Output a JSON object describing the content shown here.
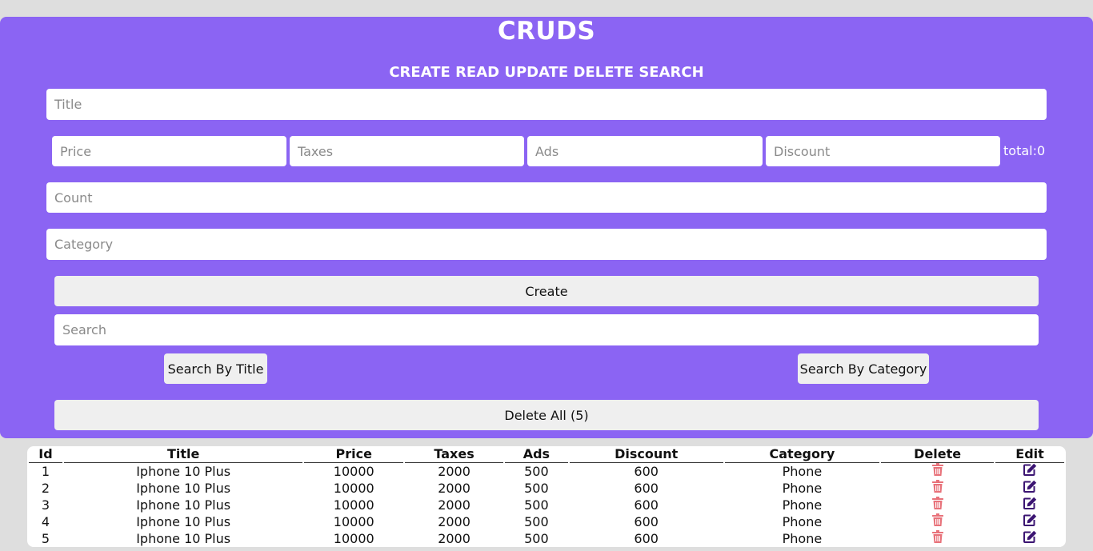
{
  "header": {
    "title": "CRUDS",
    "subtitle": "CREATE READ UPDATE DELETE SEARCH"
  },
  "form": {
    "title_placeholder": "Title",
    "price_placeholder": "Price",
    "taxes_placeholder": "Taxes",
    "ads_placeholder": "Ads",
    "discount_placeholder": "Discount",
    "total_label": "total:0",
    "count_placeholder": "Count",
    "category_placeholder": "Category",
    "create_label": "Create",
    "search_placeholder": "Search",
    "search_by_title_label": "Search By Title",
    "search_by_category_label": "Search By Category",
    "delete_all_label": "Delete All (5)"
  },
  "table": {
    "headers": [
      "Id",
      "Title",
      "Price",
      "Taxes",
      "Ads",
      "Discount",
      "Category",
      "Delete",
      "Edit"
    ],
    "rows": [
      {
        "id": "1",
        "title": "Iphone 10 Plus",
        "price": "10000",
        "taxes": "2000",
        "ads": "500",
        "discount": "600",
        "category": "Phone"
      },
      {
        "id": "2",
        "title": "Iphone 10 Plus",
        "price": "10000",
        "taxes": "2000",
        "ads": "500",
        "discount": "600",
        "category": "Phone"
      },
      {
        "id": "3",
        "title": "Iphone 10 Plus",
        "price": "10000",
        "taxes": "2000",
        "ads": "500",
        "discount": "600",
        "category": "Phone"
      },
      {
        "id": "4",
        "title": "Iphone 10 Plus",
        "price": "10000",
        "taxes": "2000",
        "ads": "500",
        "discount": "600",
        "category": "Phone"
      },
      {
        "id": "5",
        "title": "Iphone 10 Plus",
        "price": "10000",
        "taxes": "2000",
        "ads": "500",
        "discount": "600",
        "category": "Phone"
      }
    ],
    "delete_icon": "trash-icon",
    "edit_icon": "edit-icon"
  },
  "colors": {
    "panel_bg": "#8b64f3",
    "page_bg": "#dedede",
    "delete_icon": "#e8727a",
    "edit_icon": "#3b1472",
    "button_bg": "#efefef"
  }
}
